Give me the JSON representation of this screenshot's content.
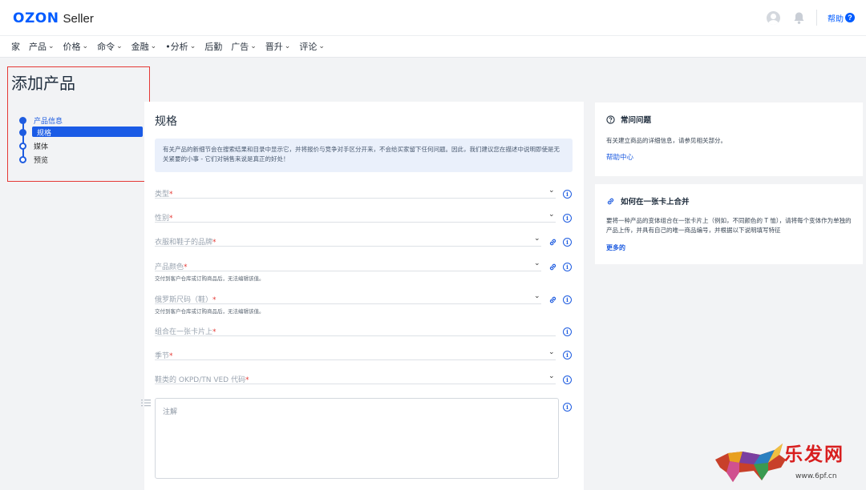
{
  "header": {
    "logo_ozon": "OZON",
    "logo_seller": "Seller",
    "help_label": "帮助",
    "help_icon": "?",
    "icons": [
      "user-avatar-icon",
      "bell-icon"
    ]
  },
  "nav": {
    "items": [
      {
        "label": "家",
        "chevron": false
      },
      {
        "label": "产品",
        "chevron": true
      },
      {
        "label": "价格",
        "chevron": true
      },
      {
        "label": "命令",
        "chevron": true
      },
      {
        "label": "金融",
        "chevron": true
      },
      {
        "label": "•分析",
        "chevron": true
      },
      {
        "label": "后勤",
        "chevron": false
      },
      {
        "label": "广告",
        "chevron": true
      },
      {
        "label": "晋升",
        "chevron": true
      },
      {
        "label": "评论",
        "chevron": true
      }
    ]
  },
  "page": {
    "title": "添加产品"
  },
  "stepper": {
    "steps": [
      {
        "label": "产品信息",
        "state": "done"
      },
      {
        "label": "规格",
        "state": "active"
      },
      {
        "label": "媒体",
        "state": "pending"
      },
      {
        "label": "预览",
        "state": "pending"
      }
    ]
  },
  "form": {
    "heading": "规格",
    "notice": "有关产品的新细节会在搜索结果和目录中显示它，并将报价与竞争对手区分开来，不会给买家留下任何问题。因此，我们建议您在描述中说明即使是无关紧要的小事 - 它们对销售来说是真正的好处！",
    "fields": [
      {
        "label": "类型",
        "required": "*",
        "help": "",
        "dropdown": true,
        "link": false
      },
      {
        "label": "性别",
        "required": "*",
        "help": "",
        "dropdown": true,
        "link": false
      },
      {
        "label": "衣服和鞋子的品牌",
        "required": "*",
        "help": "",
        "dropdown": true,
        "link": true
      },
      {
        "label": "产品颜色",
        "required": "*",
        "help": "交付到客户仓库或订购商品后，无法编辑该值。",
        "dropdown": true,
        "link": true
      },
      {
        "label": "俄罗斯尺码（鞋）",
        "required": "*",
        "help": "交付到客户仓库或订购商品后，无法编辑该值。",
        "dropdown": true,
        "link": true
      },
      {
        "label": "组合在一张卡片上",
        "required": "*",
        "help": "",
        "dropdown": false,
        "link": false
      },
      {
        "label": "季节",
        "required": "*",
        "help": "",
        "dropdown": true,
        "link": false
      },
      {
        "label": "鞋类的 OKPD/TN VED 代码",
        "required": "*",
        "help": "",
        "dropdown": true,
        "link": false
      }
    ],
    "notes_placeholder": "注解",
    "info_glyph": "i"
  },
  "faq": {
    "title": "常问问题",
    "text": "有关建立商品的详细信息，请参见相关部分。",
    "link": "帮助中心",
    "icon": "question-circle-icon"
  },
  "merge": {
    "title": "如何在一张卡上合并",
    "text": "要将一种产品的变体组合在一张卡片上（例如，不同颜色的 T 恤），请将每个变体作为单独的产品上传，并具有自己的唯一商品编号，并根据以下说明填写特征",
    "link": "更多的",
    "icon": "link-icon"
  },
  "watermark": {
    "text": "乐发网",
    "url": "www.6pf.cn"
  },
  "colors": {
    "accent": "#005bff",
    "step_blue": "#1e5ce0",
    "required_red": "#e53935",
    "highlight_frame": "#e53935"
  }
}
